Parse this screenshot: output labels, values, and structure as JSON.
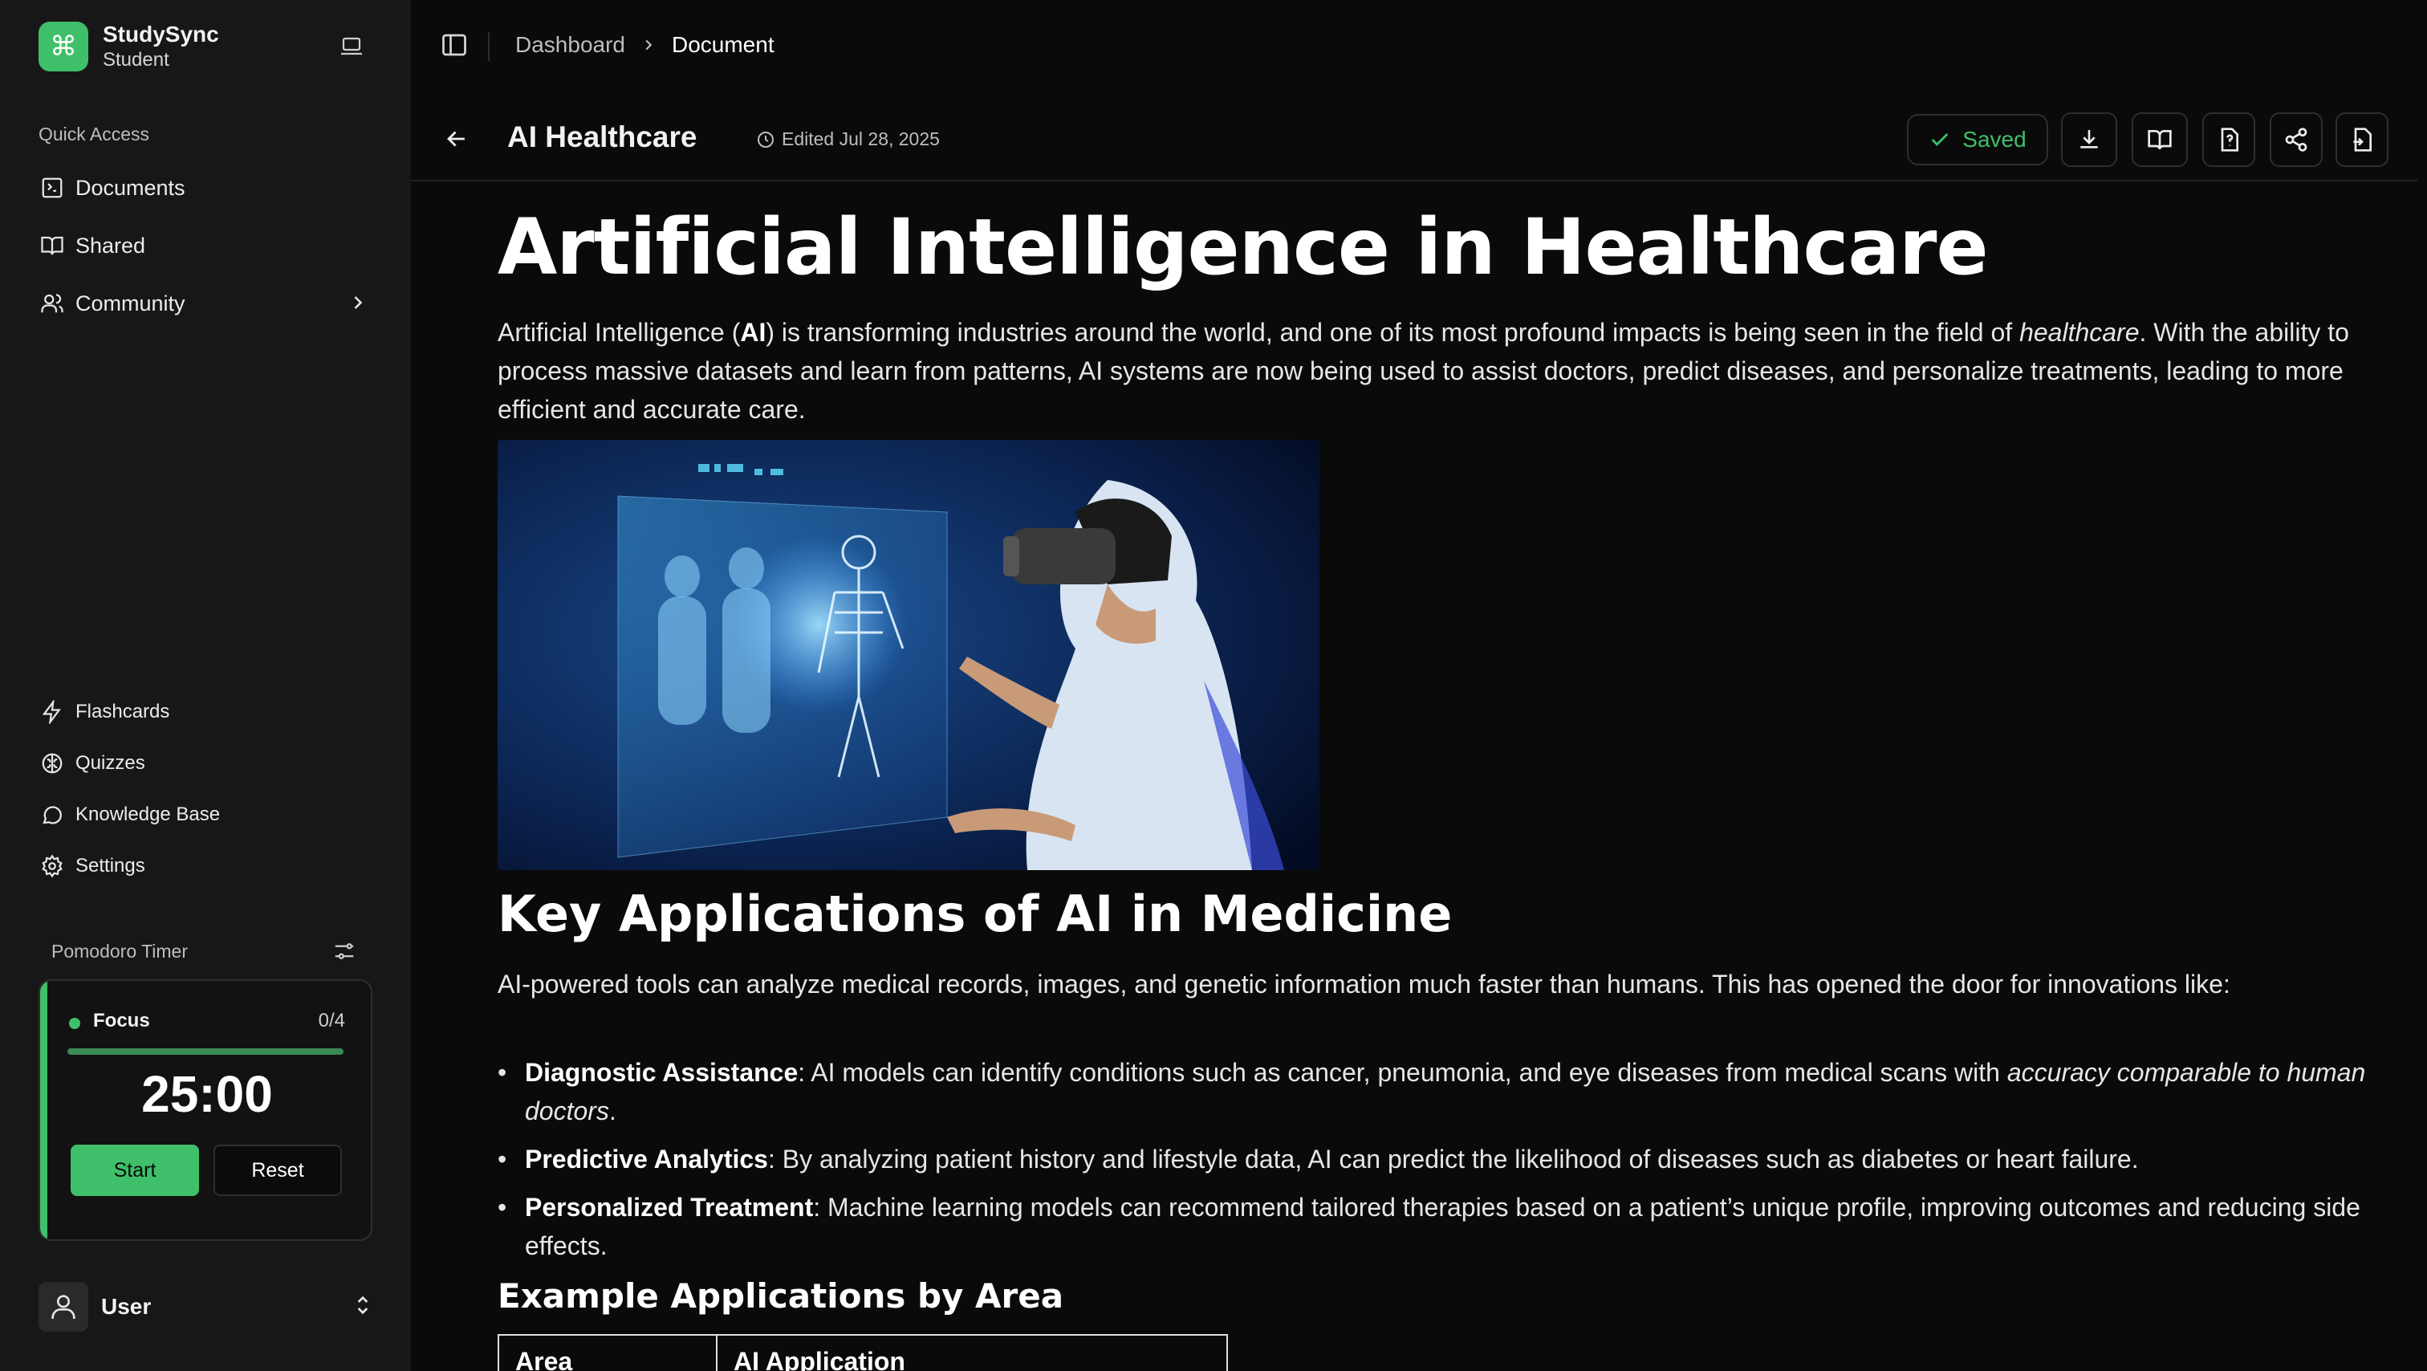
{
  "sidebar": {
    "brand": {
      "name": "StudySync",
      "role": "Student"
    },
    "quick_access_label": "Quick Access",
    "nav": [
      {
        "label": "Documents",
        "icon": "document-icon"
      },
      {
        "label": "Shared",
        "icon": "book-open-icon"
      },
      {
        "label": "Community",
        "icon": "users-icon"
      }
    ],
    "tools": [
      {
        "label": "Flashcards",
        "icon": "lightning-icon"
      },
      {
        "label": "Quizzes",
        "icon": "brain-icon"
      },
      {
        "label": "Knowledge Base",
        "icon": "chat-bubble-icon"
      },
      {
        "label": "Settings",
        "icon": "gear-icon"
      }
    ],
    "pomodoro": {
      "title": "Pomodoro Timer",
      "mode": "Focus",
      "count": "0/4",
      "time": "25:00",
      "progress": 1.0,
      "start_label": "Start",
      "reset_label": "Reset"
    },
    "user": {
      "name": "User"
    }
  },
  "breadcrumb": {
    "parent": "Dashboard",
    "current": "Document"
  },
  "document": {
    "name": "AI Healthcare",
    "edited": "Edited Jul 28, 2025",
    "saved_label": "Saved",
    "title": "Artificial Intelligence in Healthcare",
    "intro": {
      "p1": "Artificial Intelligence (",
      "p1_bold": "AI",
      "p2": ") is transforming industries around the world, and one of its most profound impacts is being seen in the field of ",
      "p2_em": "healthcare",
      "p3": ". With the ability to process massive datasets and learn from patterns, AI systems are now being used to assist doctors, predict diseases, and personalize treatments, leading to more efficient and accurate care."
    },
    "section_heading": "Key Applications of AI in Medicine",
    "section_para": "AI-powered tools can analyze medical records, images, and genetic information much faster than humans. This has opened the door for innovations like:",
    "bullets": [
      {
        "term": "Diagnostic Assistance",
        "text": ": AI models can identify conditions such as cancer, pneumonia, and eye diseases from medical scans with ",
        "em": "accuracy comparable to human doctors",
        "tail": "."
      },
      {
        "term": "Predictive Analytics",
        "text": ": By analyzing patient history and lifestyle data, AI can predict the likelihood of diseases such as diabetes or heart failure.",
        "em": "",
        "tail": ""
      },
      {
        "term": "Personalized Treatment",
        "text": ": Machine learning models can recommend tailored therapies based on a patient’s unique profile, improving outcomes and reducing side effects.",
        "em": "",
        "tail": ""
      }
    ],
    "subheading": "Example Applications by Area",
    "table_headers": [
      "Area",
      "AI Application"
    ]
  },
  "colors": {
    "accent": "#3fbf6a",
    "background": "#0a0a0a",
    "sidebar": "#171717"
  }
}
